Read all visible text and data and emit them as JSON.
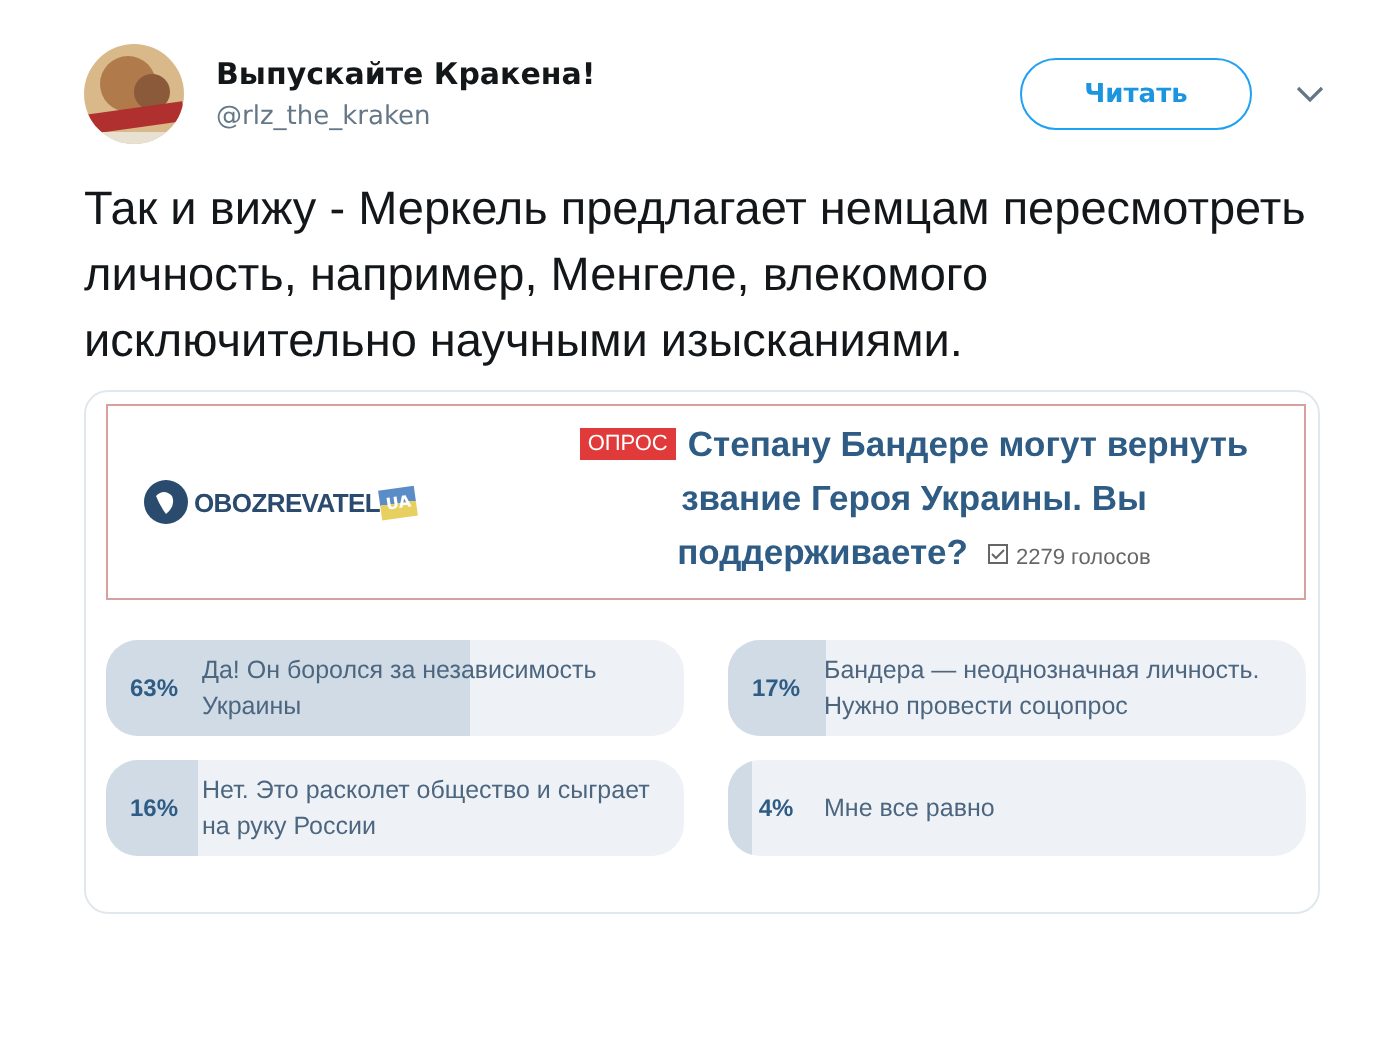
{
  "author": {
    "name": "Выпускайте Кракена!",
    "handle": "@rlz_the_kraken"
  },
  "follow_button": "Читать",
  "tweet_text": "Так и вижу - Меркель предлагает немцам пересмотреть личность, например, Менгеле, влекомого исключительно научными изысканиями.",
  "poll_card": {
    "logo": {
      "name": "OBOZREVATEL",
      "suffix": "UA"
    },
    "badge": "ОПРОС",
    "question": "Степану Бандере могут вернуть звание Героя Украины. Вы поддерживаете?",
    "votes": "2279 голосов",
    "options": [
      {
        "percent": "63%",
        "label": "Да! Он боролся за независимость Украины",
        "level": 0.63
      },
      {
        "percent": "17%",
        "label": "Бандера — неоднозначная личность. Нужно провести соцопрос",
        "level": 0.17
      },
      {
        "percent": "16%",
        "label": "Нет. Это расколет общество и сыграет на руку России",
        "level": 0.16
      },
      {
        "percent": "4%",
        "label": "Мне все равно",
        "level": 0.04
      }
    ]
  }
}
